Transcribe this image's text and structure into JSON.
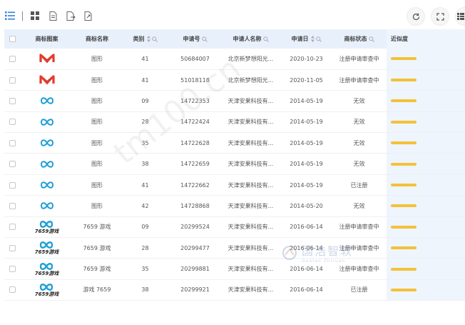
{
  "columns": {
    "pattern": "商标图案",
    "name": "商标名称",
    "category": "类别",
    "reg_no": "申请号",
    "applicant": "申请人名称",
    "date": "申请日",
    "status": "商标状态",
    "similarity": "近似度"
  },
  "rows": [
    {
      "logo": "logo-red-m",
      "name": "图形",
      "category": "41",
      "reg_no": "50684007",
      "applicant": "北京新梦想阳光...",
      "date": "2020-10-23",
      "status": "注册申请审查中"
    },
    {
      "logo": "logo-red-m",
      "name": "图形",
      "category": "41",
      "reg_no": "51018118",
      "applicant": "北京新梦想阳光...",
      "date": "2020-11-05",
      "status": "注册申请审查中"
    },
    {
      "logo": "logo-blue-infinity",
      "name": "图形",
      "category": "09",
      "reg_no": "14722353",
      "applicant": "天津安果科技有...",
      "date": "2014-05-19",
      "status": "无效"
    },
    {
      "logo": "logo-blue-infinity",
      "name": "图形",
      "category": "28",
      "reg_no": "14722424",
      "applicant": "天津安果科技有...",
      "date": "2014-05-19",
      "status": "无效"
    },
    {
      "logo": "logo-blue-infinity",
      "name": "图形",
      "category": "35",
      "reg_no": "14722628",
      "applicant": "天津安果科技有...",
      "date": "2014-05-19",
      "status": "无效"
    },
    {
      "logo": "logo-blue-infinity",
      "name": "图形",
      "category": "38",
      "reg_no": "14722659",
      "applicant": "天津安果科技有...",
      "date": "2014-05-19",
      "status": "无效"
    },
    {
      "logo": "logo-blue-infinity",
      "name": "图形",
      "category": "41",
      "reg_no": "14722662",
      "applicant": "天津安果科技有...",
      "date": "2014-05-19",
      "status": "已注册"
    },
    {
      "logo": "logo-blue-infinity",
      "name": "图形",
      "category": "42",
      "reg_no": "14728868",
      "applicant": "天津安果科技有...",
      "date": "2014-05-20",
      "status": "无效"
    },
    {
      "logo": "logo-7659-game",
      "name": "7659 游戏",
      "category": "09",
      "reg_no": "20299524",
      "applicant": "天津安果科技有...",
      "date": "2016-06-14",
      "status": "注册申请审查中"
    },
    {
      "logo": "logo-7659-game",
      "name": "7659 游戏",
      "category": "28",
      "reg_no": "20299477",
      "applicant": "天津安果科技有...",
      "date": "2016-06-14",
      "status": "注册申请审查中"
    },
    {
      "logo": "logo-7659-game",
      "name": "7659 游戏",
      "category": "35",
      "reg_no": "20299881",
      "applicant": "天津安果科技有...",
      "date": "2016-06-14",
      "status": "注册申请审查中"
    },
    {
      "logo": "logo-7659-game",
      "name": "游戏 7659",
      "category": "38",
      "reg_no": "20299921",
      "applicant": "天津安果科技有...",
      "date": "2016-06-14",
      "status": "已注册"
    }
  ],
  "logo_text": "7659游戏",
  "watermark": "tm100.cn",
  "brand": {
    "cn": "国浩智软",
    "en": "Guotao Zhiruan"
  },
  "colors": {
    "header_bg": "#e8f1fb",
    "accent_blue": "#3b8bd6",
    "similarity_bar": "#f3c13a",
    "logo_red": "#e23b2e",
    "logo_cyan": "#1e9fd8"
  }
}
